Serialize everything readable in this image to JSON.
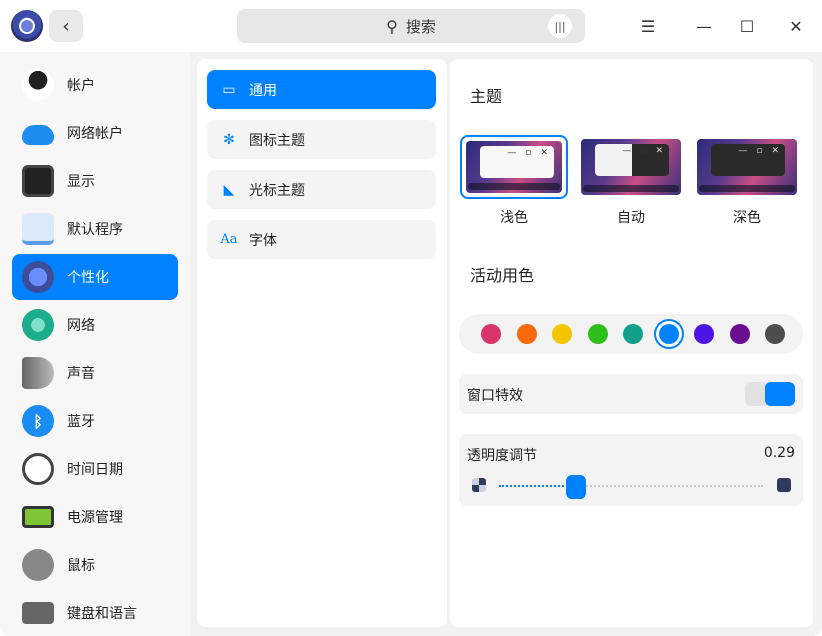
{
  "header": {
    "back_icon": "chevron-left-icon",
    "search_placeholder": "搜索",
    "window_buttons": [
      "menu-icon",
      "minimize-icon",
      "maximize-icon",
      "close-icon"
    ]
  },
  "sidebar": {
    "items": [
      {
        "label": "帐户",
        "icon": "account-icon"
      },
      {
        "label": "网络帐户",
        "icon": "cloud-icon"
      },
      {
        "label": "显示",
        "icon": "display-icon"
      },
      {
        "label": "默认程序",
        "icon": "default-apps-icon"
      },
      {
        "label": "个性化",
        "icon": "personalization-icon",
        "active": true
      },
      {
        "label": "网络",
        "icon": "network-icon"
      },
      {
        "label": "声音",
        "icon": "sound-icon"
      },
      {
        "label": "蓝牙",
        "icon": "bluetooth-icon"
      },
      {
        "label": "时间日期",
        "icon": "clock-icon"
      },
      {
        "label": "电源管理",
        "icon": "battery-icon"
      },
      {
        "label": "鼠标",
        "icon": "mouse-icon"
      },
      {
        "label": "键盘和语言",
        "icon": "keyboard-icon"
      }
    ]
  },
  "submenu": {
    "items": [
      {
        "label": "通用",
        "icon": "window-icon",
        "active": true
      },
      {
        "label": "图标主题",
        "icon": "flower-icon"
      },
      {
        "label": "光标主题",
        "icon": "cursor-icon"
      },
      {
        "label": "字体",
        "icon": "font-icon",
        "glyph": "Aa"
      }
    ]
  },
  "content": {
    "theme_title": "主题",
    "themes": [
      {
        "label": "浅色",
        "selected": true
      },
      {
        "label": "自动",
        "selected": false
      },
      {
        "label": "深色",
        "selected": false
      }
    ],
    "accent_title": "活动用色",
    "accent_colors": [
      "#d8356a",
      "#f66a0a",
      "#f5c400",
      "#2dbe19",
      "#12a08a",
      "#0081ff",
      "#4b16e3",
      "#6a0d91",
      "#4d4d4d"
    ],
    "selected_accent_index": 5,
    "window_effect": {
      "label": "窗口特效",
      "enabled": true
    },
    "transparency": {
      "label": "透明度调节",
      "value": "0.29",
      "level": 0.29
    }
  }
}
